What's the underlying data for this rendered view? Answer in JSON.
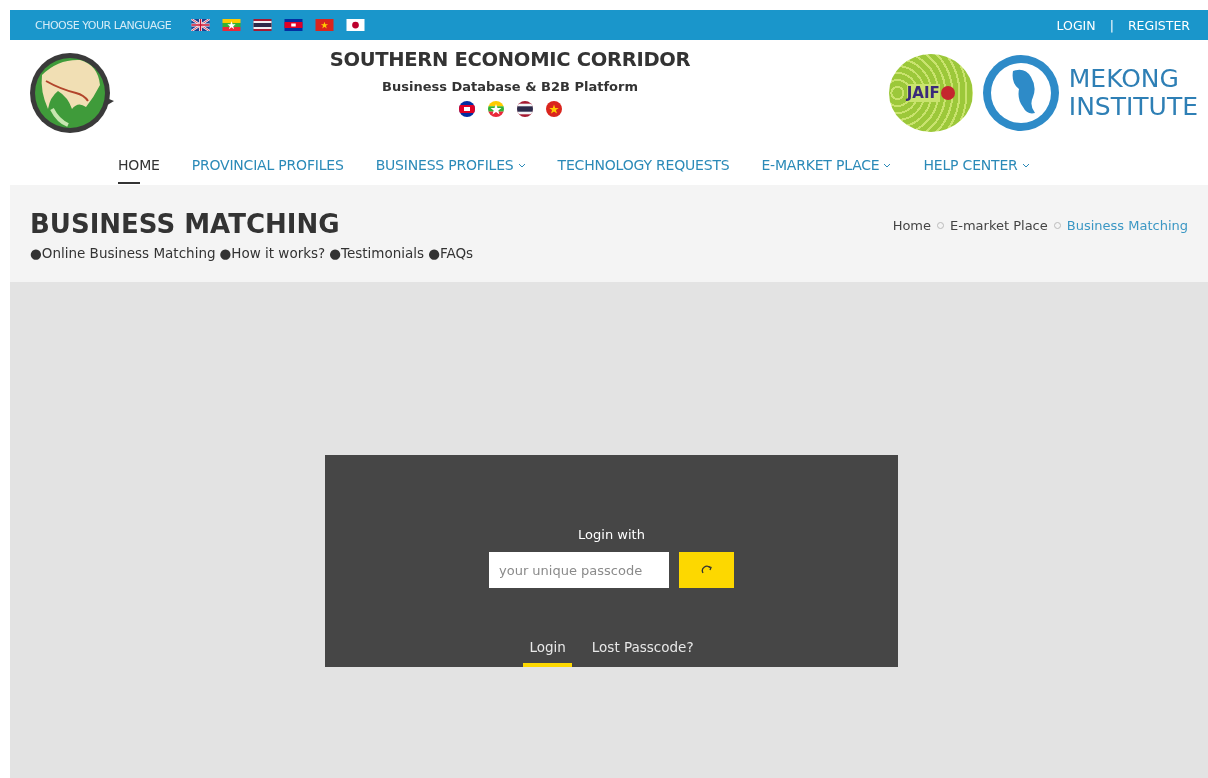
{
  "top_bar": {
    "language_label": "CHOOSE YOUR LANGUAGE",
    "flags": [
      {
        "kind": "uk"
      },
      {
        "kind": "myanmar"
      },
      {
        "kind": "thailand"
      },
      {
        "kind": "cambodia"
      },
      {
        "kind": "vietnam"
      },
      {
        "kind": "japan"
      }
    ],
    "links": [
      "LOGIN",
      "REGISTER"
    ],
    "separator": "|"
  },
  "header": {
    "title": "SOUTHERN ECONOMIC CORRIDOR",
    "subtitle": "Business Database & B2B Platform",
    "round_flags": [
      {
        "kind": "cambodia"
      },
      {
        "kind": "myanmar"
      },
      {
        "kind": "thailand"
      },
      {
        "kind": "vietnam"
      }
    ],
    "partner_logo": "JAIF",
    "institute_lines": [
      "MEKONG",
      "INSTITUTE"
    ]
  },
  "nav": [
    {
      "label": "HOME",
      "selected": true,
      "dropdown": false
    },
    {
      "label": "PROVINCIAL PROFILES",
      "selected": false,
      "dropdown": false
    },
    {
      "label": "BUSINESS PROFILES",
      "selected": false,
      "dropdown": true
    },
    {
      "label": "TECHNOLOGY REQUESTS",
      "selected": false,
      "dropdown": false
    },
    {
      "label": "E-MARKET PLACE",
      "selected": false,
      "dropdown": true
    },
    {
      "label": "HELP CENTER",
      "selected": false,
      "dropdown": true
    }
  ],
  "page_title": {
    "heading": "BUSINESS MATCHING",
    "sub_links": [
      "●Online Business Matching",
      "●How it works?",
      "●Testimonials",
      "●FAQs"
    ],
    "breadcrumb": [
      {
        "label": "Home",
        "current": false
      },
      {
        "label": "E-market Place",
        "current": false
      },
      {
        "label": "Business Matching",
        "current": true
      }
    ]
  },
  "login_panel": {
    "heading": "Login with",
    "passcode_field": {
      "placeholder": "your unique passcode"
    },
    "tabs": [
      {
        "label": "Login",
        "selected": true
      },
      {
        "label": "Lost Passcode?",
        "selected": false
      }
    ]
  }
}
